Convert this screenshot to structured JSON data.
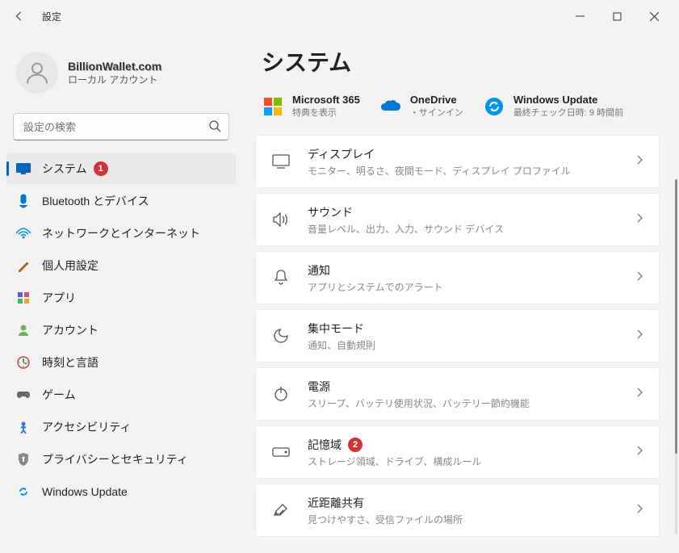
{
  "window": {
    "title": "設定"
  },
  "user": {
    "name": "BillionWallet.com",
    "sub": "ローカル アカウント"
  },
  "search": {
    "placeholder": "設定の検索"
  },
  "nav": [
    {
      "label": "システム",
      "active": true,
      "badge": "1"
    },
    {
      "label": "Bluetooth とデバイス"
    },
    {
      "label": "ネットワークとインターネット"
    },
    {
      "label": "個人用設定"
    },
    {
      "label": "アプリ"
    },
    {
      "label": "アカウント"
    },
    {
      "label": "時刻と言語"
    },
    {
      "label": "ゲーム"
    },
    {
      "label": "アクセシビリティ"
    },
    {
      "label": "プライバシーとセキュリティ"
    },
    {
      "label": "Windows Update"
    }
  ],
  "main": {
    "title": "システム",
    "top": [
      {
        "title": "Microsoft 365",
        "sub": "特典を表示"
      },
      {
        "title": "OneDrive",
        "sub": "・サインイン"
      },
      {
        "title": "Windows Update",
        "sub": "最終チェック日時: 9 時間前"
      }
    ],
    "items": [
      {
        "title": "ディスプレイ",
        "sub": "モニター、明るさ、夜間モード、ディスプレイ プロファイル"
      },
      {
        "title": "サウンド",
        "sub": "音量レベル、出力、入力、サウンド デバイス"
      },
      {
        "title": "通知",
        "sub": "アプリとシステムでのアラート"
      },
      {
        "title": "集中モード",
        "sub": "通知、自動規則"
      },
      {
        "title": "電源",
        "sub": "スリープ、バッテリ使用状況、バッテリー節約機能"
      },
      {
        "title": "記憶域",
        "sub": "ストレージ領域、ドライブ、構成ルール",
        "badge": "2"
      },
      {
        "title": "近距離共有",
        "sub": "見つけやすさ、受信ファイルの場所"
      }
    ]
  }
}
